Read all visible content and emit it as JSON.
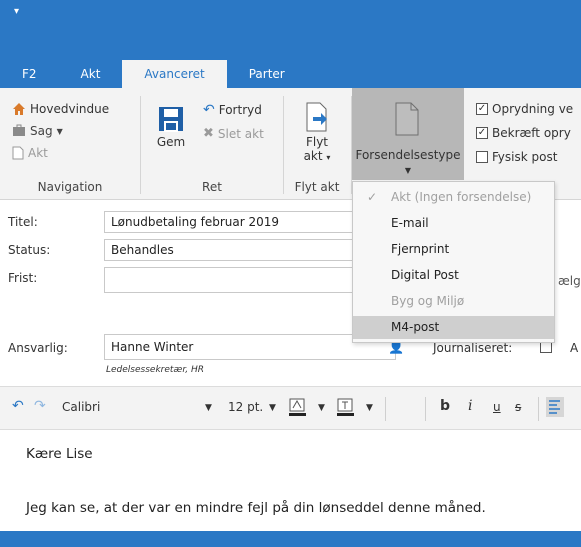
{
  "window": {
    "qat_icon": "▾"
  },
  "tabs": [
    {
      "label": "F2",
      "active": false
    },
    {
      "label": "Akt",
      "active": false
    },
    {
      "label": "Avanceret",
      "active": true
    },
    {
      "label": "Parter",
      "active": false
    }
  ],
  "ribbon": {
    "navigation": {
      "label": "Navigation",
      "hovedvindue": "Hovedvindue",
      "sag": "Sag",
      "akt": "Akt"
    },
    "ret": {
      "label": "Ret",
      "gem": "Gem",
      "fortryd": "Fortryd",
      "slet_akt": "Slet akt"
    },
    "flyt": {
      "label": "Flyt akt",
      "button_line1": "Flyt",
      "button_line2": "akt"
    },
    "forsendelsestype": {
      "label": "Forsendelsestype"
    },
    "checkboxes": [
      {
        "label": "Oprydning ve",
        "checked": true
      },
      {
        "label": "Bekræft opry",
        "checked": true
      },
      {
        "label": "Fysisk post",
        "checked": false
      }
    ]
  },
  "form": {
    "titel_label": "Titel:",
    "titel_value": "Lønudbetaling februar 2019",
    "status_label": "Status:",
    "status_value": "Behandles",
    "frist_label": "Frist:",
    "frist_right_text": "ælg",
    "ansvarlig_label": "Ansvarlig:",
    "ansvarlig_value": "Hanne Winter",
    "ansvarlig_subtitle": "Ledelsessekretær, HR",
    "journal_label": "Journaliseret:",
    "journal_right_text": "A"
  },
  "toolbar": {
    "font": "Calibri",
    "size": "12 pt.",
    "bold": "b",
    "italic": "i",
    "underline": "u",
    "strike": "s"
  },
  "editor": {
    "line1": "Kære Lise",
    "line2": "Jeg kan se, at der var en mindre fejl på din lønseddel denne måned."
  },
  "dropdown": {
    "items": [
      {
        "label": "Akt (Ingen forsendelse)",
        "disabled": true,
        "checked": true
      },
      {
        "label": "E-mail",
        "disabled": false
      },
      {
        "label": "Fjernprint",
        "disabled": false
      },
      {
        "label": "Digital Post",
        "disabled": false
      },
      {
        "label": "Byg og Miljø",
        "disabled": true
      },
      {
        "label": "M4-post",
        "disabled": false,
        "highlighted": true
      }
    ]
  },
  "colors": {
    "accent": "#2b78c5",
    "ribbon_bg": "#f3f3f3",
    "selected_button": "#b7b7b7"
  }
}
